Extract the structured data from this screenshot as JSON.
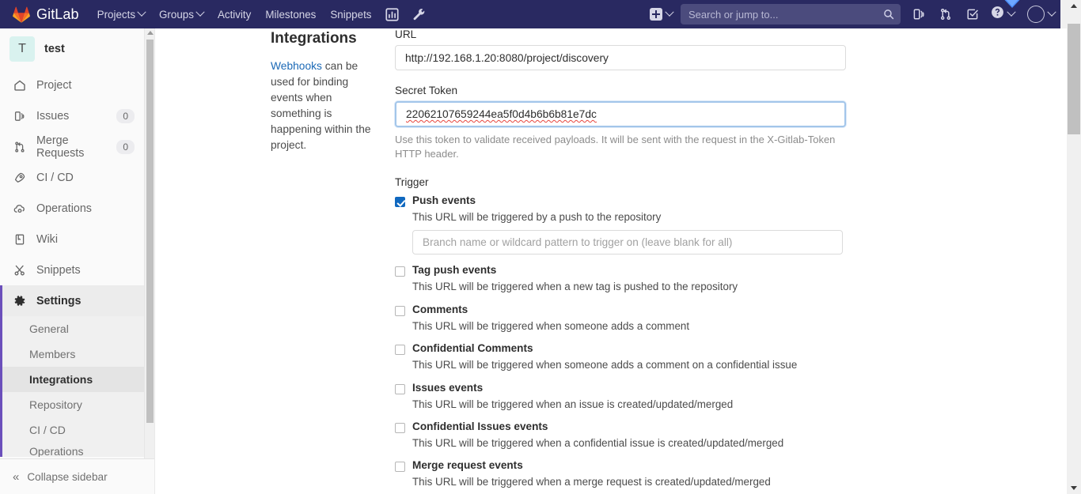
{
  "navbar": {
    "brand": "GitLab",
    "links": [
      {
        "label": "Projects",
        "has_chevron": true,
        "icon": ""
      },
      {
        "label": "Groups",
        "has_chevron": true,
        "icon": ""
      },
      {
        "label": "Activity",
        "has_chevron": false,
        "icon": ""
      },
      {
        "label": "Milestones",
        "has_chevron": false,
        "icon": ""
      },
      {
        "label": "Snippets",
        "has_chevron": false,
        "icon": ""
      }
    ],
    "icon_links": [
      {
        "name": "analytics-chart-icon"
      },
      {
        "name": "admin-wrench-icon"
      }
    ],
    "create_new": {
      "icon": "plus-square-icon",
      "has_chevron": true
    },
    "search": {
      "placeholder": "Search or jump to...",
      "value": "",
      "icon": "search-icon"
    },
    "right_icons": [
      {
        "name": "issues-icon"
      },
      {
        "name": "merge-requests-icon"
      },
      {
        "name": "todos-icon"
      }
    ],
    "help": {
      "icon": "help-circle-icon",
      "has_chevron": true
    },
    "avatar": {
      "icon": "user-avatar-icon",
      "has_chevron": true
    },
    "colors": {
      "background": "#292961",
      "text": "#d6d6e7",
      "search_bg": "#4b4b7d"
    }
  },
  "sidebar": {
    "project": {
      "initial": "T",
      "name": "test",
      "avatar_bg": "#d9f2ef"
    },
    "items": [
      {
        "label": "Project",
        "icon": "home-icon",
        "badge": ""
      },
      {
        "label": "Issues",
        "icon": "issues-icon",
        "badge": "0"
      },
      {
        "label": "Merge Requests",
        "icon": "merge-request-icon",
        "badge": "0"
      },
      {
        "label": "CI / CD",
        "icon": "rocket-icon",
        "badge": ""
      },
      {
        "label": "Operations",
        "icon": "cloud-gear-icon",
        "badge": ""
      },
      {
        "label": "Wiki",
        "icon": "book-icon",
        "badge": ""
      },
      {
        "label": "Snippets",
        "icon": "scissors-icon",
        "badge": ""
      },
      {
        "label": "Settings",
        "icon": "gear-icon",
        "badge": "",
        "active": true
      }
    ],
    "settings_subitems": [
      {
        "label": "General",
        "active": false
      },
      {
        "label": "Members",
        "active": false
      },
      {
        "label": "Integrations",
        "active": true
      },
      {
        "label": "Repository",
        "active": false
      },
      {
        "label": "CI / CD",
        "active": false
      },
      {
        "label": "Operations",
        "active": false
      }
    ],
    "collapse": {
      "label": "Collapse sidebar",
      "icon": "double-chevron-left-icon"
    },
    "active_accent": "#6b4fbb"
  },
  "main": {
    "heading": "Integrations",
    "description_link": "Webhooks",
    "description_rest": " can be used for binding events when something is happening within the project.",
    "fields": {
      "url": {
        "label": "URL",
        "value": "http://192.168.1.20:8080/project/discovery",
        "placeholder": ""
      },
      "secret_token": {
        "label": "Secret Token",
        "value": "22062107659244ea5f0d4b6b6b81e7dc",
        "placeholder": "",
        "focused": true,
        "spellcheck_error": true,
        "help": "Use this token to validate received payloads. It will be sent with the request in the X-Gitlab-Token HTTP header."
      }
    },
    "trigger": {
      "title": "Trigger",
      "events": [
        {
          "name": "Push events",
          "description": "This URL will be triggered by a push to the repository",
          "checked": true,
          "branch_input_placeholder": "Branch name or wildcard pattern to trigger on (leave blank for all)",
          "branch_input_value": ""
        },
        {
          "name": "Tag push events",
          "description": "This URL will be triggered when a new tag is pushed to the repository",
          "checked": false
        },
        {
          "name": "Comments",
          "description": "This URL will be triggered when someone adds a comment",
          "checked": false
        },
        {
          "name": "Confidential Comments",
          "description": "This URL will be triggered when someone adds a comment on a confidential issue",
          "checked": false
        },
        {
          "name": "Issues events",
          "description": "This URL will be triggered when an issue is created/updated/merged",
          "checked": false
        },
        {
          "name": "Confidential Issues events",
          "description": "This URL will be triggered when a confidential issue is created/updated/merged",
          "checked": false
        },
        {
          "name": "Merge request events",
          "description": "This URL will be triggered when a merge request is created/updated/merged",
          "checked": false
        }
      ]
    }
  },
  "colors": {
    "accent_purple": "#6b4fbb",
    "checkbox_blue": "#1068bf",
    "link_blue": "#1b69b6",
    "navbar_bg": "#292961",
    "focus_border": "#a3c6ea",
    "spellcheck_red": "#e8453c"
  }
}
